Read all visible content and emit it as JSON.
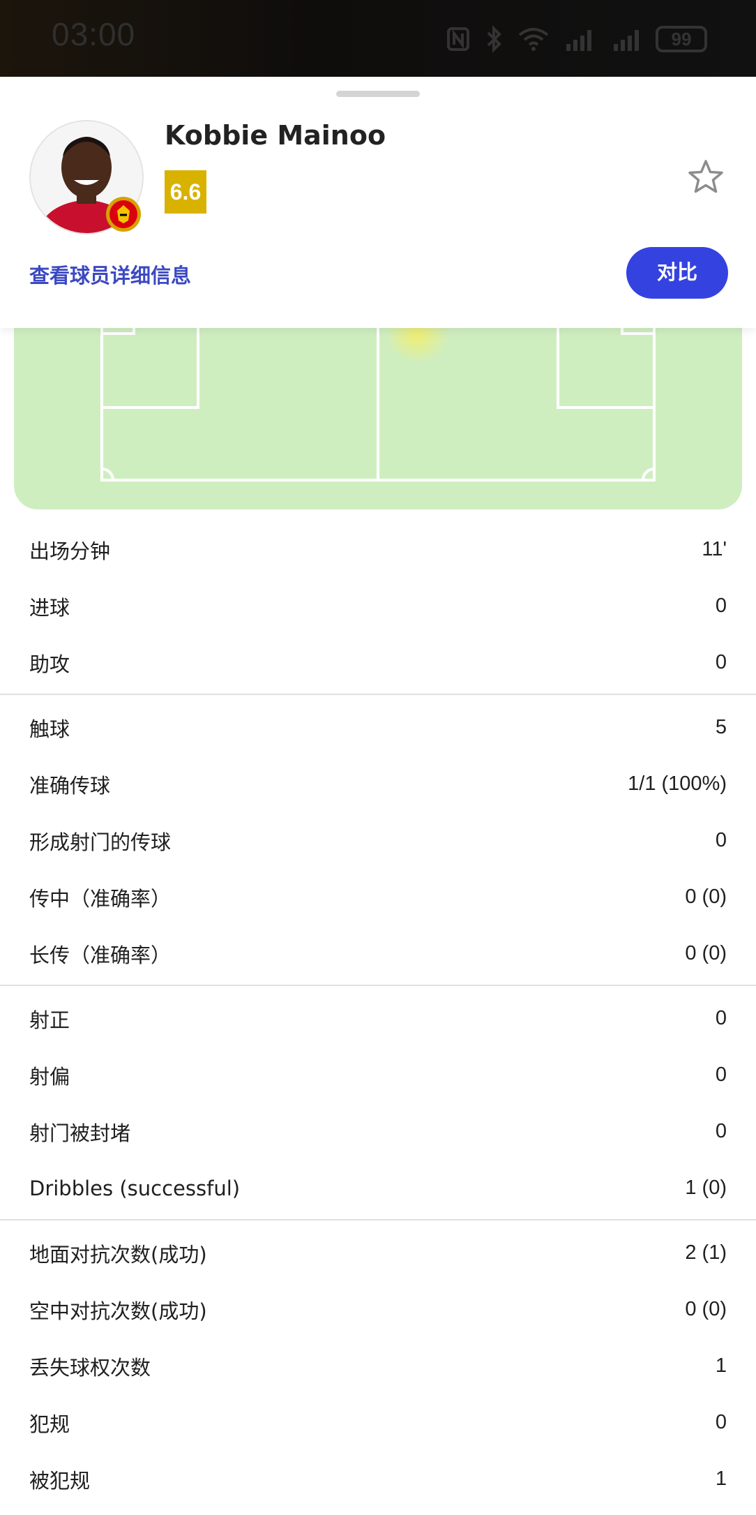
{
  "status_bar": {
    "time": "03:00",
    "battery": "99",
    "icons": [
      "nfc-icon",
      "bluetooth-icon",
      "wifi-icon",
      "signal-icon",
      "signal-icon-2",
      "battery-icon"
    ]
  },
  "player": {
    "name": "Kobbie Mainoo",
    "rating": "6.6",
    "details_link": "查看球员详细信息",
    "compare_label": "对比"
  },
  "colors": {
    "pitch": "#cfeec0",
    "rating_badge": "#d9b200",
    "compare_button": "#3443e0",
    "link": "#3b49c2"
  },
  "stat_groups": [
    {
      "rows": [
        {
          "label": "出场分钟",
          "value": "11'"
        },
        {
          "label": "进球",
          "value": "0"
        },
        {
          "label": "助攻",
          "value": "0"
        }
      ]
    },
    {
      "rows": [
        {
          "label": "触球",
          "value": "5"
        },
        {
          "label": "准确传球",
          "value": "1/1 (100%)"
        },
        {
          "label": "形成射门的传球",
          "value": "0"
        },
        {
          "label": "传中（准确率）",
          "value": "0 (0)"
        },
        {
          "label": "长传（准确率）",
          "value": "0 (0)"
        }
      ]
    },
    {
      "rows": [
        {
          "label": "射正",
          "value": "0"
        },
        {
          "label": "射偏",
          "value": "0"
        },
        {
          "label": "射门被封堵",
          "value": "0"
        },
        {
          "label": "Dribbles (successful)",
          "value": "1 (0)"
        }
      ]
    },
    {
      "rows": [
        {
          "label": "地面对抗次数(成功)",
          "value": "2 (1)"
        },
        {
          "label": "空中对抗次数(成功)",
          "value": "0 (0)"
        },
        {
          "label": "丢失球权次数",
          "value": "1"
        },
        {
          "label": "犯规",
          "value": "0"
        },
        {
          "label": "被犯规",
          "value": "1"
        }
      ]
    }
  ]
}
